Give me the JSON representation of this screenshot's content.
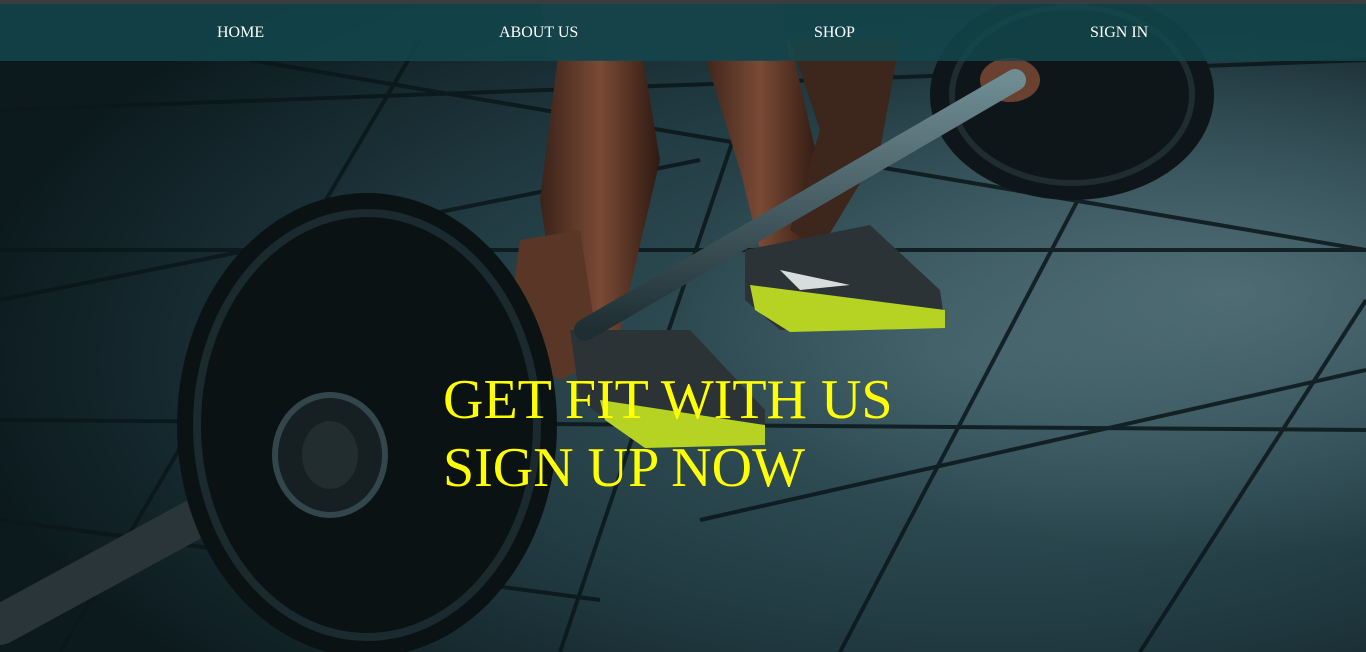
{
  "nav": {
    "items": [
      {
        "label": "HOME"
      },
      {
        "label": "ABOUT US"
      },
      {
        "label": "SHOP"
      },
      {
        "label": "SIGN IN"
      }
    ]
  },
  "hero": {
    "line1": "GET FIT WITH US",
    "line2": "SIGN UP NOW",
    "text_color": "#ffff00"
  },
  "colors": {
    "navbar_bg": "#12484e",
    "nav_text": "#ffffff"
  }
}
